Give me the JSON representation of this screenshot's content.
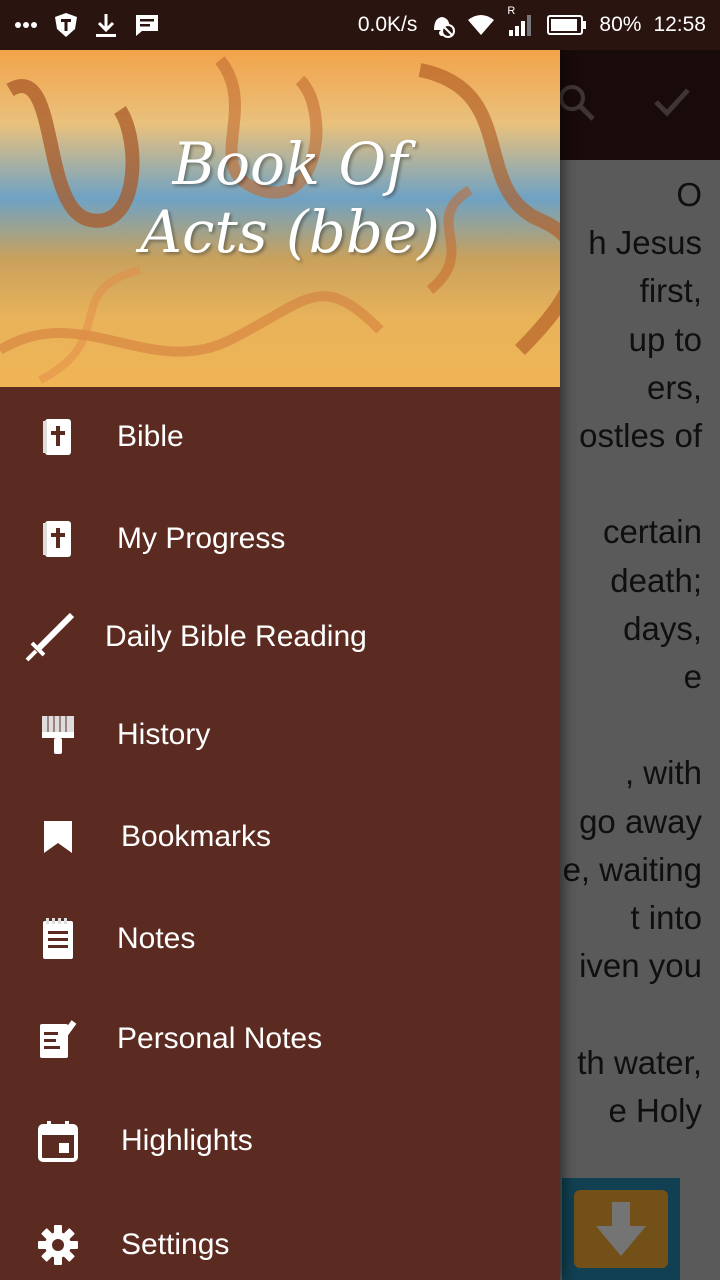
{
  "status_bar": {
    "speed": "0.0K/s",
    "battery": "80%",
    "time": "12:58",
    "roaming": "R"
  },
  "background": {
    "lines": [
      "O",
      "h Jesus",
      "first,",
      "up to",
      "ers,",
      "ostles of",
      "",
      "certain",
      "death;",
      " days,",
      "e",
      "",
      ", with",
      "go away",
      "e, waiting",
      "t into",
      "iven you",
      "",
      "th water,",
      "e Holy"
    ]
  },
  "drawer": {
    "header_title_line1": "Book Of",
    "header_title_line2": "Acts (bbe)",
    "items": [
      {
        "label": "Bible",
        "icon": "bible-icon"
      },
      {
        "label": "My Progress",
        "icon": "bible-icon"
      },
      {
        "label": "Daily Bible Reading",
        "icon": "sword-icon"
      },
      {
        "label": "History",
        "icon": "brush-icon"
      },
      {
        "label": "Bookmarks",
        "icon": "bookmark-icon"
      },
      {
        "label": "Notes",
        "icon": "notes-icon"
      },
      {
        "label": "Personal Notes",
        "icon": "personal-notes-icon"
      },
      {
        "label": "Highlights",
        "icon": "calendar-icon"
      },
      {
        "label": "Settings",
        "icon": "gear-icon"
      }
    ]
  },
  "colors": {
    "drawer_bg": "#5b2b22",
    "toolbar_bg": "#2a1410",
    "download_btn": "#c68a2a"
  }
}
